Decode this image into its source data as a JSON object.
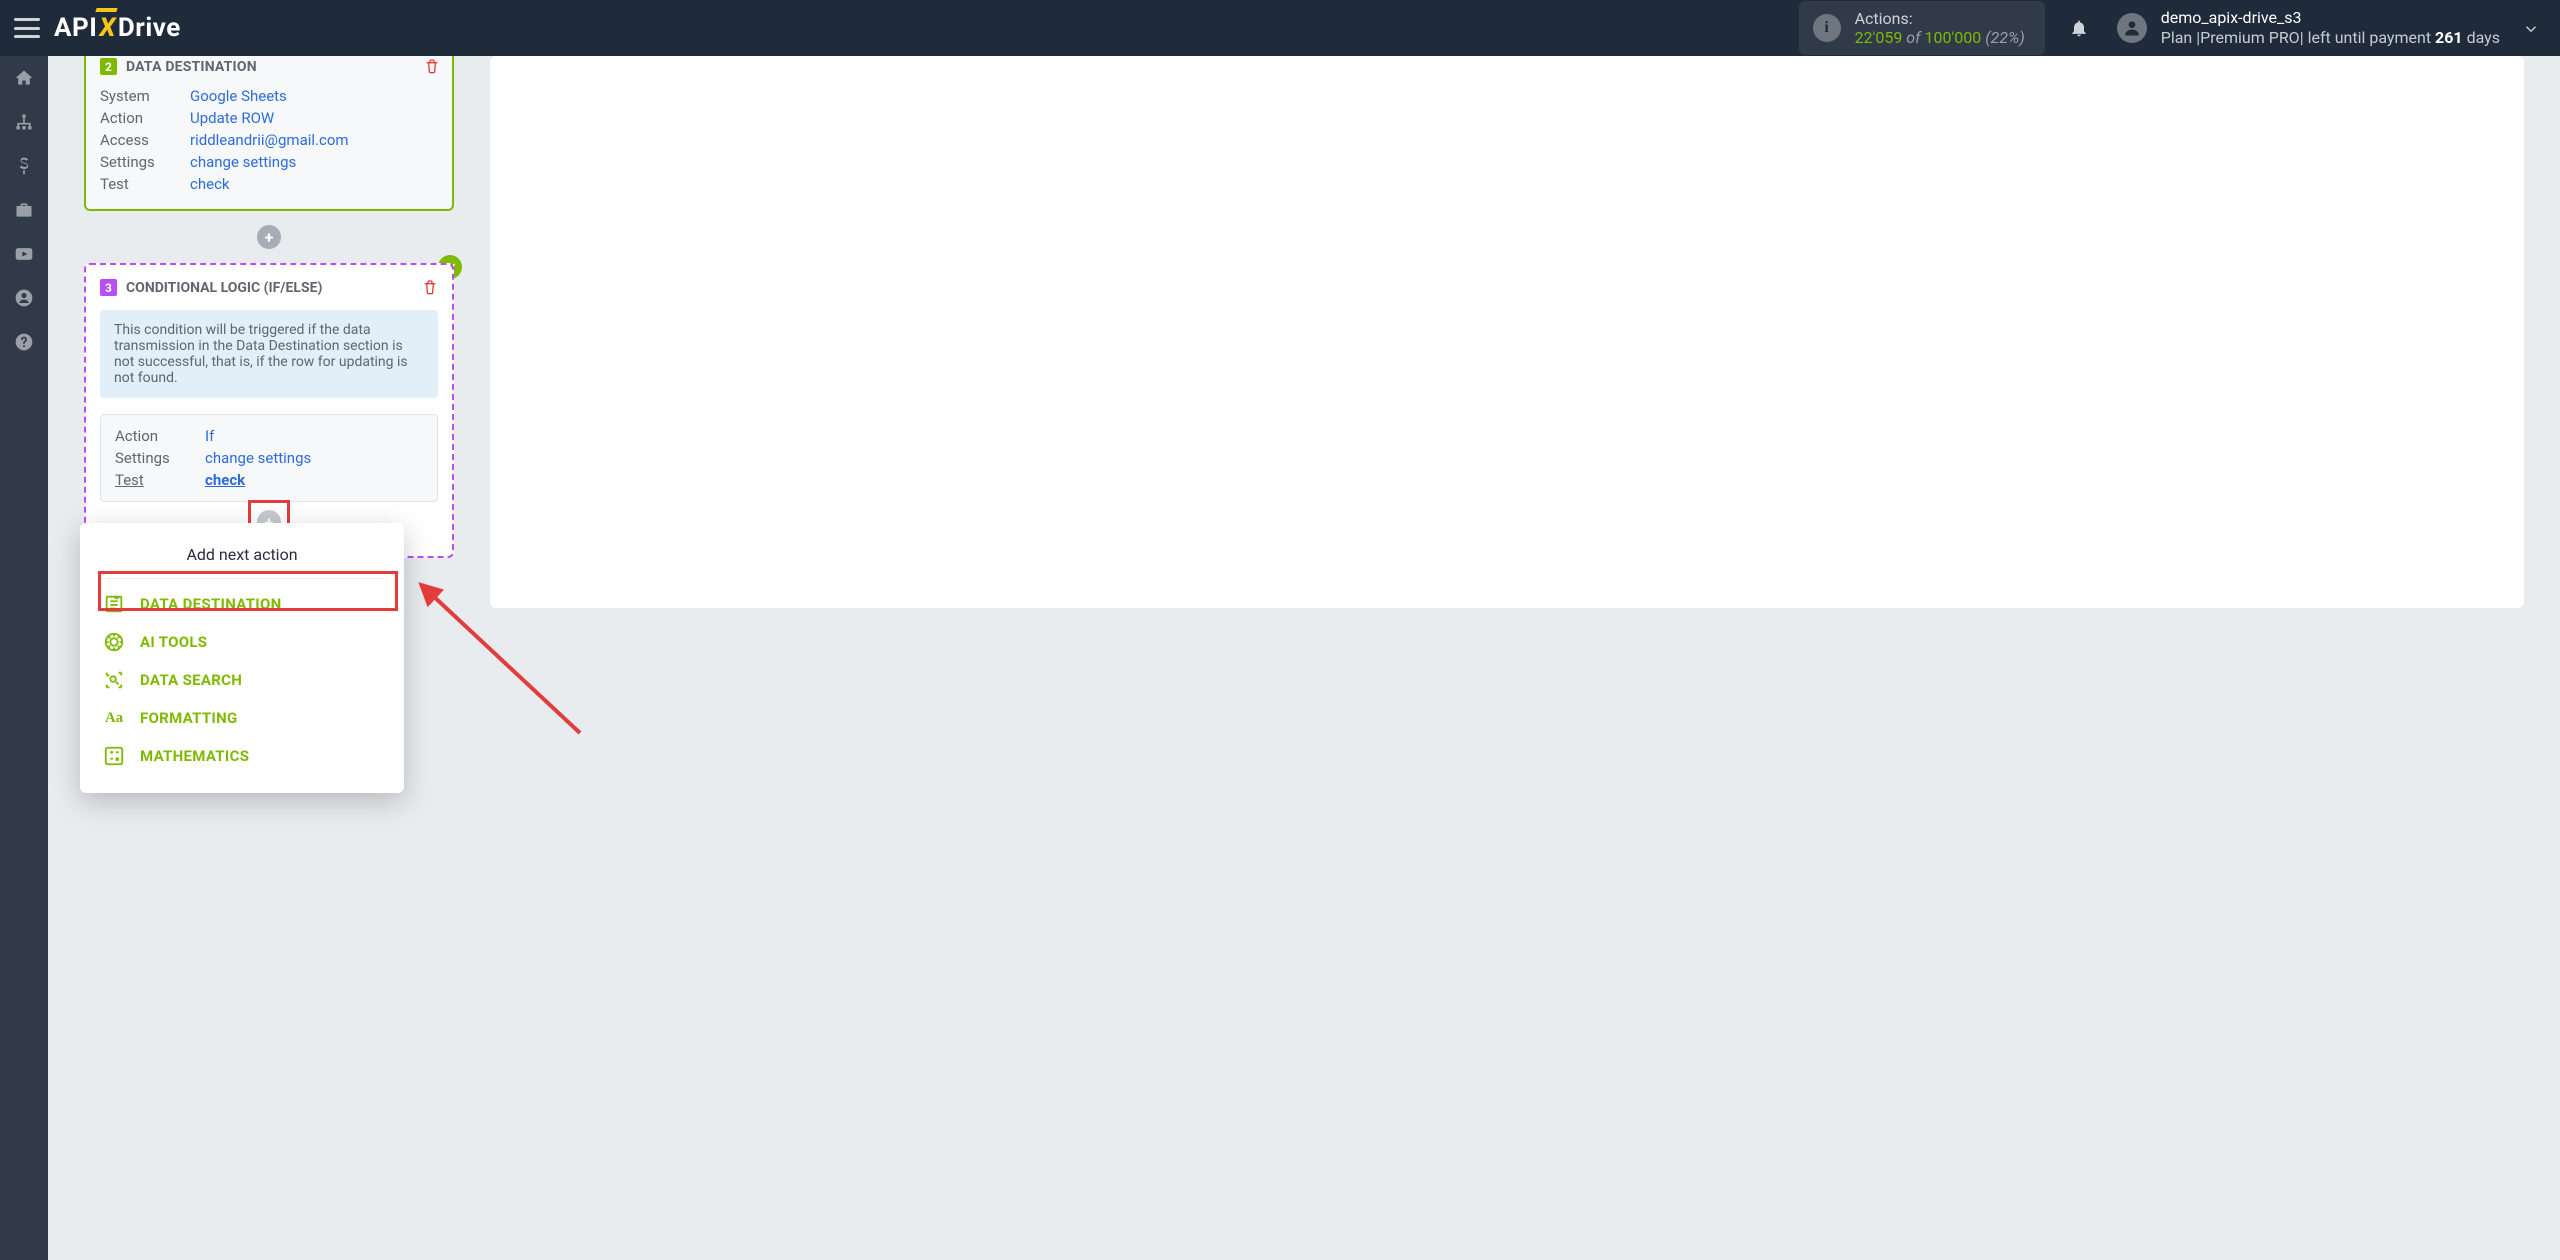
{
  "header": {
    "logo_api": "API",
    "logo_drive": "Drive",
    "actions": {
      "label": "Actions:",
      "current": "22'059",
      "of": "of",
      "max": "100'000",
      "pct": "(22%)"
    },
    "user": {
      "name": "demo_apix-drive_s3",
      "plan_prefix": "Plan |Premium PRO| left until payment ",
      "days_num": "261",
      "days_word": " days"
    }
  },
  "step2": {
    "num": "2",
    "title": "DATA DESTINATION",
    "rows": {
      "system_k": "System",
      "system_v": "Google Sheets",
      "action_k": "Action",
      "action_v": "Update ROW",
      "access_k": "Access",
      "access_v": "riddleandrii@gmail.com",
      "settings_k": "Settings",
      "settings_v": "change settings",
      "test_k": "Test",
      "test_v": "check"
    }
  },
  "step3": {
    "num": "3",
    "title": "CONDITIONAL LOGIC (IF/ELSE)",
    "desc": "This condition will be triggered if the data transmission in the Data Destination section is not successful, that is, if the row for updating is not found.",
    "rows": {
      "action_k": "Action",
      "action_v": "If",
      "settings_k": "Settings",
      "settings_v": "change settings",
      "test_k": "Test",
      "test_v": "check"
    }
  },
  "popup": {
    "title": "Add next action",
    "items": {
      "data_destination": "DATA DESTINATION",
      "ai_tools": "AI TOOLS",
      "data_search": "DATA SEARCH",
      "formatting": "FORMATTING",
      "formatting_icon": "Aa",
      "mathematics": "MATHEMATICS"
    }
  }
}
